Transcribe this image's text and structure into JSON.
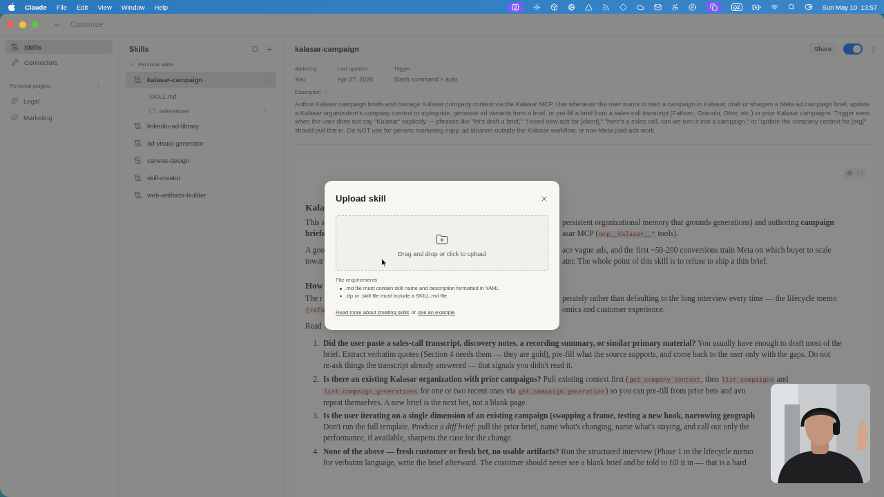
{
  "menu_bar": {
    "app": "Claude",
    "menus": [
      "File",
      "Edit",
      "View",
      "Window",
      "Help"
    ],
    "badge": "QZ",
    "date": "Sun May 10",
    "time": "13:57"
  },
  "window": {
    "title": "Customize"
  },
  "sidebar": {
    "items": [
      {
        "label": "Skills",
        "selected": true
      },
      {
        "label": "Connectors",
        "selected": false
      }
    ],
    "section": "Personal plugins",
    "plugins": [
      "Legal",
      "Marketing"
    ]
  },
  "skills_panel": {
    "title": "Skills",
    "group": {
      "label": "Personal skills",
      "expanded": true
    },
    "items": [
      {
        "label": "kalasar-campaign",
        "selected": true,
        "expanded": true,
        "children": [
          {
            "label": "SKILL.md",
            "kind": "file"
          },
          {
            "label": "references",
            "kind": "folder",
            "expanded": false
          }
        ]
      },
      {
        "label": "linkedin-ad-library",
        "selected": false
      },
      {
        "label": "ad-visual-generator",
        "selected": false
      },
      {
        "label": "canvas-design",
        "selected": false
      },
      {
        "label": "skill-creator",
        "selected": false
      },
      {
        "label": "web-artifacts-builder",
        "selected": false
      }
    ]
  },
  "header": {
    "title": "kalasar-campaign",
    "share": "Share",
    "share_toggle": {
      "on": true
    }
  },
  "meta": [
    {
      "label": "Added by",
      "value": "You"
    },
    {
      "label": "Last updated",
      "value": "Apr 27, 2026"
    },
    {
      "label": "Trigger",
      "value": "Slash command + auto"
    }
  ],
  "description": {
    "label": "Description",
    "text": "Author Kalasar campaign briefs and manage Kalasar company context via the Kalasar MCP. Use whenever the user wants to start a campaign in Kalasar, draft or sharpen a Meta ad campaign brief, update a Kalasar organization's company context or styleguide, generate ad variants from a brief, or pre-fill a brief from a sales-call transcript (Fathom, Granola, Otter, etc.) or prior Kalasar campaigns. Trigger even when the user does not say \"Kalasar\" explicitly — phrases like \"let's draft a brief,\" \"I need new ads for [client],\" \"here's a sales call, can we turn it into a campaign,\" or \"update the company context for [org]\" should pull this in. Do NOT use for generic marketing copy, ad ideation outside the Kalasar workflow, or non-Meta paid-ads work."
  },
  "document": {
    "rows": [
      {
        "kind": "heading",
        "left": [
          {
            "kind": "text",
            "text": "Kala"
          }
        ]
      },
      {
        "kind": "text",
        "left": [
          {
            "kind": "text",
            "text": "This s"
          }
        ],
        "right": [
          {
            "kind": "text",
            "text": "persistent organizational memory that grounds generations) and authoring **campaign**"
          }
        ]
      },
      {
        "kind": "text",
        "left": [
          {
            "kind": "text",
            "text": "**briefs**"
          }
        ],
        "right": [
          {
            "kind": "text",
            "text": "asar MCP ("
          },
          {
            "kind": "code",
            "text": "mcp__kalasar__*"
          },
          {
            "kind": "text",
            "text": " tools)."
          }
        ]
      },
      {
        "kind": "gap"
      },
      {
        "kind": "text",
        "left": [
          {
            "kind": "text",
            "text": "A goo"
          }
        ],
        "right": [
          {
            "kind": "text",
            "text": "ace vague ads, and the first ~50-200 conversions train Meta on which buyer to scale"
          }
        ]
      },
      {
        "kind": "text",
        "left": [
          {
            "kind": "text",
            "text": "towar"
          }
        ],
        "right": [
          {
            "kind": "text",
            "text": "ater. The whole point of this skill is to refuse to ship a thin brief."
          }
        ]
      },
      {
        "kind": "subheading",
        "left": [
          {
            "kind": "text",
            "text": "How"
          }
        ]
      },
      {
        "kind": "text",
        "left": [
          {
            "kind": "text",
            "text": "The r"
          }
        ],
        "right": [
          {
            "kind": "text",
            "text": "perately rather than defaulting to the long interview every time — the lifecycle memo"
          }
        ]
      },
      {
        "kind": "text",
        "left": [
          {
            "kind": "code",
            "text": "(refe"
          }
        ],
        "right": [
          {
            "kind": "text",
            "text": "omics and customer experience."
          }
        ]
      },
      {
        "kind": "gap"
      },
      {
        "kind": "text",
        "left": [
          {
            "kind": "text",
            "text": "Read"
          }
        ]
      }
    ],
    "list": [
      {
        "number": "1.",
        "lines": [
          [
            {
              "kind": "text",
              "text": "**Did the user paste a sales-call transcript, discovery notes, a recording summary, or similar primary material?** You usually have enough to draft most of the"
            }
          ],
          [
            {
              "kind": "text",
              "text": "brief. Extract verbatim quotes (Section 4 needs them — they are gold), pre-fill what the source supports, and come back to the user only with the gaps. Do not"
            }
          ],
          [
            {
              "kind": "text",
              "text": "re-ask things the transcript already answered — that signals you didn't read it."
            }
          ]
        ]
      },
      {
        "number": "2.",
        "lines": [
          [
            {
              "kind": "text",
              "text": "**Is there an existing Kalasar organization with prior campaigns?** Pull existing context first ("
            },
            {
              "kind": "code",
              "text": "get_company_context"
            },
            {
              "kind": "text",
              "text": ", then "
            },
            {
              "kind": "code",
              "text": "list_campaigns"
            },
            {
              "kind": "text",
              "text": " and"
            }
          ],
          [
            {
              "kind": "code",
              "text": "list_campaign_generations"
            },
            {
              "kind": "text",
              "text": " for one or two recent ones via "
            },
            {
              "kind": "code",
              "text": "get_campaign_generation"
            },
            {
              "kind": "text",
              "text": ") so you can pre-fill from prior bets and avo"
            }
          ],
          [
            {
              "kind": "text",
              "text": "repeat themselves. A new brief is the next bet, not a blank page."
            }
          ]
        ]
      },
      {
        "number": "3.",
        "lines": [
          [
            {
              "kind": "text",
              "text": "**Is the user iterating on a single dimension of an existing campaign (swapping a frame, testing a new hook, narrowing geograph**"
            }
          ],
          [
            {
              "kind": "text",
              "text": "Don't run the full template. Produce a *diff brief*: pull the prior brief, name what's changing, name what's staying, and call out only the"
            }
          ],
          [
            {
              "kind": "text",
              "text": "performance, if available, sharpens the case for the change."
            }
          ]
        ]
      },
      {
        "number": "4.",
        "lines": [
          [
            {
              "kind": "text",
              "text": "**None of the above — fresh customer or fresh bet, no usable artifacts?** Run the structured interview (Phase 1 in the lifecycle memo"
            }
          ],
          [
            {
              "kind": "text",
              "text": "for verbatim language, write the brief afterward. The customer should never see a blank brief and be told to fill it in — that is a hard"
            }
          ]
        ]
      }
    ]
  },
  "modal": {
    "title": "Upload skill",
    "dropzone": "Drag and drop or click to upload",
    "requirements_title": "File requirements",
    "requirements": [
      ".md file must contain skill name and description formatted in YAML",
      ".zip or .skill file must include a SKILL.md file"
    ],
    "link_1": "Read more about creating skills",
    "joiner": "or",
    "link_2": "see an example"
  }
}
